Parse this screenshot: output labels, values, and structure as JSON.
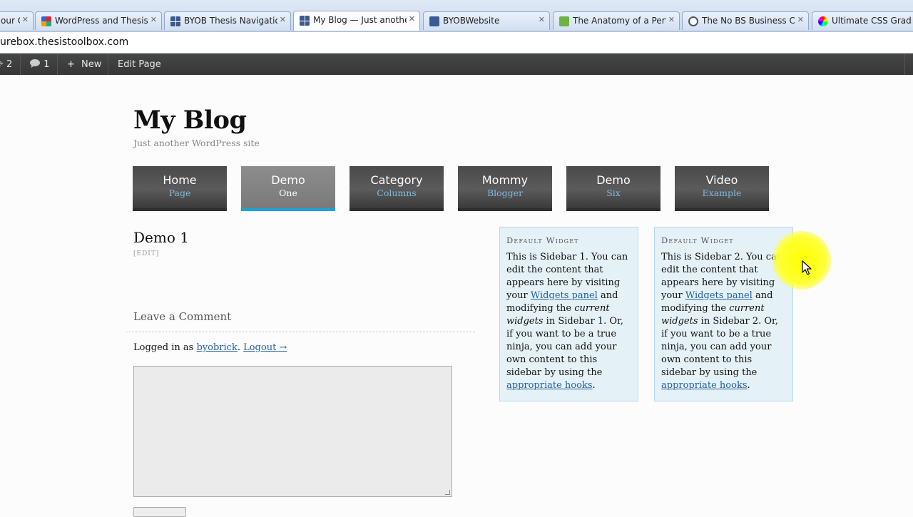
{
  "browser": {
    "tabs": [
      {
        "title": "our O",
        "icon": "tab-partial-icon"
      },
      {
        "title": "WordPress and Thesis Tu",
        "icon": "google-grid-icon"
      },
      {
        "title": "BYOB Thesis Navigation",
        "icon": "grid-icon"
      },
      {
        "title": "My Blog — Just another",
        "icon": "grid-icon"
      },
      {
        "title": "BYOBWebsite",
        "icon": "facebook-icon"
      },
      {
        "title": "The Anatomy of a Perfec",
        "icon": "green-doc-icon"
      },
      {
        "title": "The No BS Business Coac",
        "icon": "globe-icon"
      },
      {
        "title": "Ultimate CSS Gradient",
        "icon": "color-wheel-icon"
      }
    ],
    "url": "urebox.thesistoolbox.com"
  },
  "adminbar": {
    "updates_count": "2",
    "comments_count": "1",
    "new_label": "New",
    "edit_label": "Edit Page"
  },
  "site": {
    "title": "My Blog",
    "description": "Just another WordPress site"
  },
  "nav": [
    {
      "label": "Home",
      "sub": "Page"
    },
    {
      "label": "Demo",
      "sub": "One"
    },
    {
      "label": "Category",
      "sub": "Columns"
    },
    {
      "label": "Mommy",
      "sub": "Blogger"
    },
    {
      "label": "Demo",
      "sub": "Six"
    },
    {
      "label": "Video",
      "sub": "Example"
    }
  ],
  "post": {
    "title": "Demo 1",
    "edit": "[EDIT]",
    "leave_comment": "Leave a Comment",
    "logged_in_prefix": "Logged in as ",
    "username": "byobrick",
    "separator": ". ",
    "logout": "Logout →"
  },
  "widgets": [
    {
      "heading": "Default Widget",
      "t1": "This is Sidebar 1. You can edit the content that appears here by visiting your ",
      "link1": "Widgets panel",
      "t2": " and modifying the ",
      "em": "current widgets",
      "t3": " in Sidebar 1. Or, if you want to be a true ninja, you can add your own content to this sidebar by using the ",
      "link2": "appropriate hooks",
      "t4": "."
    },
    {
      "heading": "Default Widget",
      "t1": "This is Sidebar 2. You can edit the content that appears here by visiting your ",
      "link1": "Widgets panel",
      "t2": " and modifying the ",
      "em": "current widgets",
      "t3": " in Sidebar 2. Or, if you want to be a true ninja, you can add your own content to this sidebar by using the ",
      "link2": "appropriate hooks",
      "t4": "."
    }
  ],
  "colors": {
    "admin_bar": "#373737",
    "nav_active_underline": "#1fa3d8",
    "link": "#2361a1",
    "widget_bg": "#e4f1f6",
    "cursor_highlight": "#ffff00"
  }
}
